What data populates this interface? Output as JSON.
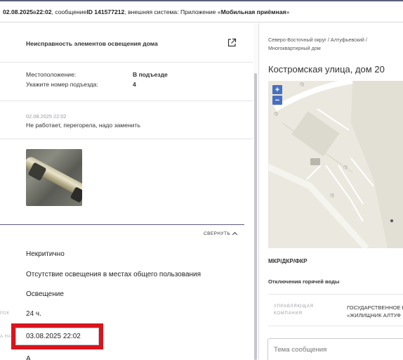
{
  "topbar": {
    "date": "02.08.2025",
    "at": " в ",
    "time": "22:02",
    "sep": ", сообщение ",
    "id_label": "ID 141577212",
    "system_text": ", внешняя система: Приложение «",
    "app_name": "Мобильная приёмная",
    "close_quote": "»"
  },
  "request": {
    "title": "Неисправность элементов освещения дома",
    "location_label": "Местоположение:",
    "location_value": "В подъезде",
    "entrance_label": "Укажите номер подъезда:",
    "entrance_value": "4",
    "comment_date": "02.08.2025 22:02",
    "comment_text": "Не работает, перегорела, надо заменить"
  },
  "details": {
    "collapse_label": "СВЕРНУТЬ",
    "criticality": "Некритично",
    "problem": "Отсутствие освещения в местах общего пользования",
    "category": "Освещение",
    "deadline_side_label": "РОК",
    "deadline": "24 ч.",
    "start_side_label": "А НА",
    "start_date": "03.08.2025 22:02",
    "next_value": "А"
  },
  "right": {
    "breadcrumbs": "Северо-Восточный округ / Алтуфьевский / Многоквартирный дом",
    "address": "Костромская улица, дом 20",
    "zoom_in": "+",
    "zoom_out": "−",
    "parking_glyph": "P",
    "house_type": "МКР/ДКР/ФКР",
    "hot_water": "Отключения горячей воды",
    "mgmt_label": "УПРАВЛЯЮЩАЯ КОМПАНИЯ",
    "mgmt_value_line1": "ГОСУДАРСТВЕННОЕ Б",
    "mgmt_value_line2": "«ЖИЛИЩНИК АЛТУФ",
    "message_placeholder": "Тема сообщения"
  },
  "colors": {
    "accent_border": "#5b5f7a",
    "highlight_red": "#d9141c",
    "zoom_blue": "#4a6fbf",
    "map_bg": "#ebe8df"
  },
  "icons": {
    "external": "external-link-icon",
    "collapse": "chevron-up-icon"
  }
}
